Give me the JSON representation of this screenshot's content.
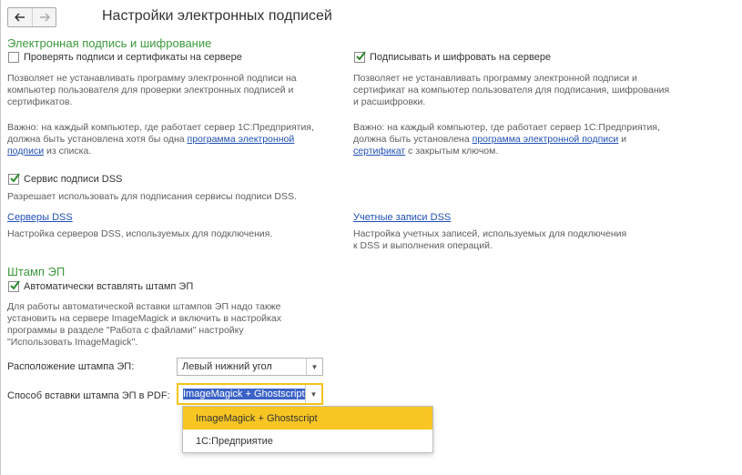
{
  "header": {
    "back_icon": "arrow-left-icon",
    "forward_icon": "arrow-right-icon",
    "title": "Настройки электронных подписей"
  },
  "signature_section": {
    "title": "Электронная подпись и шифрование",
    "check_on_server": {
      "label": "Проверять подписи и сертификаты на сервере",
      "checked": false,
      "note1": "Позволяет не устанавливать программу электронной подписи на",
      "note2": "компьютер пользователя для проверки электронных подписей и",
      "note3": "сертификатов.",
      "important1": "Важно: на каждый компьютер, где работает сервер 1С:Предприятия,",
      "important2_pre": "должна быть установлена хотя бы одна ",
      "important2_link": "программа электронной",
      "important3_link": "подписи",
      "important3_post": " из списка."
    },
    "sign_on_server": {
      "label": "Подписывать и шифровать на сервере",
      "checked": true,
      "note1": "Позволяет не устанавливать программу электронной подписи и",
      "note2": "сертификат на компьютер пользователя для подписания, шифрования",
      "note3": "и расшифровки.",
      "important1": "Важно: на каждый компьютер, где работает сервер 1С:Предприятия,",
      "important2_pre": "должна быть установлена ",
      "important2_link": "программа электронной подписи",
      "important2_post": " и",
      "important3_link": "сертификат",
      "important3_post": " с закрытым ключом."
    },
    "dss": {
      "label": "Сервис подписи DSS",
      "checked": true,
      "note": "Разрешает использовать для подписания сервисы подписи DSS.",
      "servers_link": "Серверы DSS",
      "servers_note": "Настройка серверов DSS, используемых для подключения.",
      "accounts_link": "Учетные записи DSS",
      "accounts_note1": "Настройка учетных записей, используемых для подключения",
      "accounts_note2": "к DSS и выполнения операций."
    }
  },
  "stamp_section": {
    "title": "Штамп ЭП",
    "auto_insert": {
      "label": "Автоматически вставлять штамп ЭП",
      "checked": true
    },
    "note1": "Для работы автоматической вставки штампов ЭП надо также",
    "note2": "установить на сервере ImageMagick и включить в настройках",
    "note3": "программы в разделе \"Работа с файлами\" настройку",
    "note4": "\"Использовать ImageMagick\".",
    "location_label": "Расположение штампа ЭП:",
    "location_value": "Левый нижний угол",
    "method_label": "Способ вставки штампа ЭП в PDF:",
    "method_value": "ImageMagick + Ghostscript",
    "method_options": [
      "ImageMagick + Ghostscript",
      "1С:Предприятие"
    ],
    "selected_option": "ImageMagick + Ghostscript"
  },
  "colors": {
    "section_title": "#3d9a3d",
    "link": "#1f4fb6",
    "highlight": "#f7c623",
    "selection": "#3b63c7"
  }
}
